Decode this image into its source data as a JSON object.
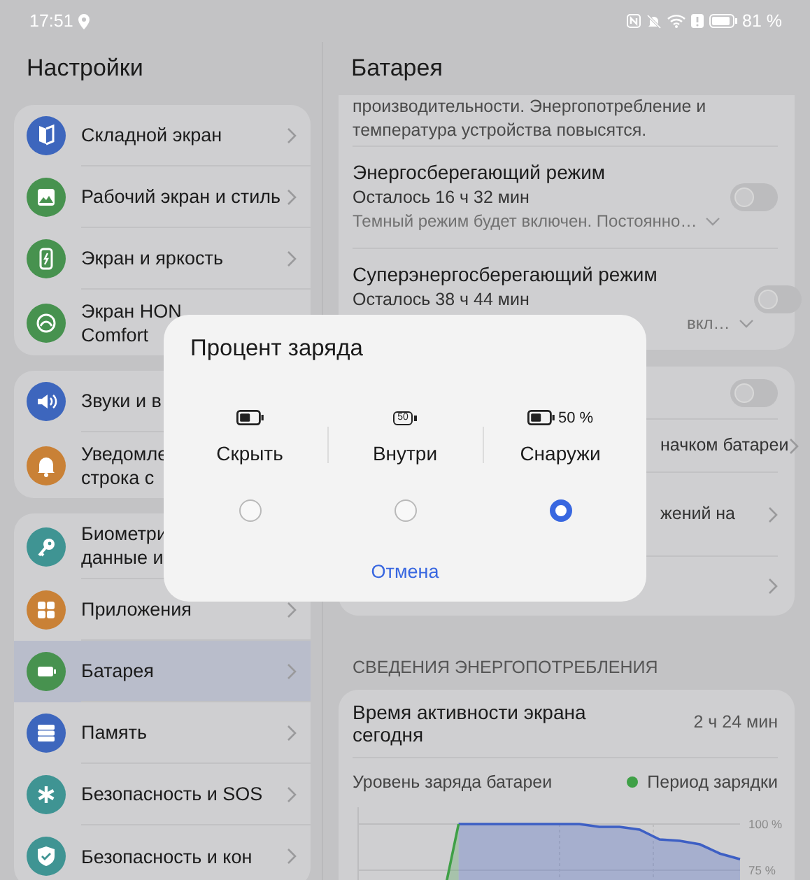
{
  "status_bar": {
    "time": "17:51",
    "battery": "81 %"
  },
  "sidebar": {
    "title": "Настройки",
    "groups": [
      {
        "items": [
          {
            "label": "Складной экран",
            "color": "#3d66bd",
            "selected": false,
            "chevron": true
          },
          {
            "label": "Рабочий экран и стиль",
            "color": "#47924f",
            "selected": false,
            "chevron": true
          },
          {
            "label": "Экран и яркость",
            "color": "#47924f",
            "selected": false,
            "chevron": true
          },
          {
            "label": "Экран HON\nComfort",
            "color": "#47924f",
            "selected": false,
            "chevron": false
          }
        ]
      },
      {
        "items": [
          {
            "label": "Звуки и в",
            "color": "#3d66bd",
            "selected": false,
            "chevron": false
          },
          {
            "label": "Уведомле\nстрока с",
            "color": "#c98136",
            "selected": false,
            "chevron": false
          }
        ]
      },
      {
        "items": [
          {
            "label": "Биометри\nданные и",
            "color": "#3f9493",
            "selected": false,
            "chevron": false
          },
          {
            "label": "Приложения",
            "color": "#c98136",
            "selected": false,
            "chevron": true
          },
          {
            "label": "Батарея",
            "color": "#47924f",
            "selected": true,
            "chevron": true
          },
          {
            "label": "Память",
            "color": "#3d66bd",
            "selected": false,
            "chevron": true
          },
          {
            "label": "Безопасность и SOS",
            "color": "#3f9493",
            "selected": false,
            "chevron": true
          },
          {
            "label": "Безопасность и кон",
            "color": "#3f9493",
            "selected": false,
            "chevron": true
          }
        ]
      }
    ]
  },
  "battery_page": {
    "title": "Батарея",
    "top_note": "производительности. Энергопотребление и температура устройства повысятся.",
    "modes": [
      {
        "title": "Энергосберегающий режим",
        "remaining": "Осталось 16 ч 32 мин",
        "description": "Темный режим будет включен. Постоянно…",
        "kind": "full",
        "on": false
      },
      {
        "title": "Суперэнергосберегающий режим",
        "remaining": "Осталось 38 ч 44 мин",
        "description": "вкл…",
        "kind": "covered",
        "on": false
      }
    ],
    "settings": [
      {
        "kind": "toggle",
        "on": false
      },
      {
        "kind": "link",
        "label": "начком батареи"
      },
      {
        "kind": "link",
        "label": "жений на"
      },
      {
        "kind": "link"
      }
    ],
    "section": "СВЕДЕНИЯ ЭНЕРГОПОТРЕБЛЕНИЯ",
    "usage": {
      "title": "Время активности экрана сегодня",
      "value": "2 ч 24 мин",
      "chart_data": {
        "type": "area",
        "title": "Уровень заряда батареи",
        "ylim": [
          0,
          100
        ],
        "yticks": [
          {
            "value": 100,
            "label": "100 %"
          },
          {
            "value": 75,
            "label": "75 %"
          }
        ],
        "series": [
          {
            "color": "#3d5fc4",
            "values": [
              null,
              null,
              null,
              null,
              null,
              100,
              100,
              100,
              100,
              100,
              100,
              100,
              98.5,
              98.5,
              97,
              91.7,
              90.9,
              89,
              84,
              81
            ]
          },
          {
            "name": "Период зарядки",
            "color": "#3fa047",
            "values": [
              null,
              null,
              null,
              null,
              48,
              100,
              null,
              null,
              null,
              null,
              null,
              null,
              null,
              null,
              null,
              null,
              null,
              null,
              null,
              null
            ]
          }
        ]
      }
    }
  },
  "dialog": {
    "title": "Процент заряда",
    "options": [
      {
        "label": "Скрыть",
        "kind": "hidden",
        "selected": false
      },
      {
        "label": "Внутри",
        "kind": "inside",
        "icon_text": "50",
        "selected": false
      },
      {
        "label": "Снаружи",
        "kind": "outside",
        "icon_text": "50 %",
        "selected": true
      }
    ],
    "cancel": "Отмена"
  }
}
